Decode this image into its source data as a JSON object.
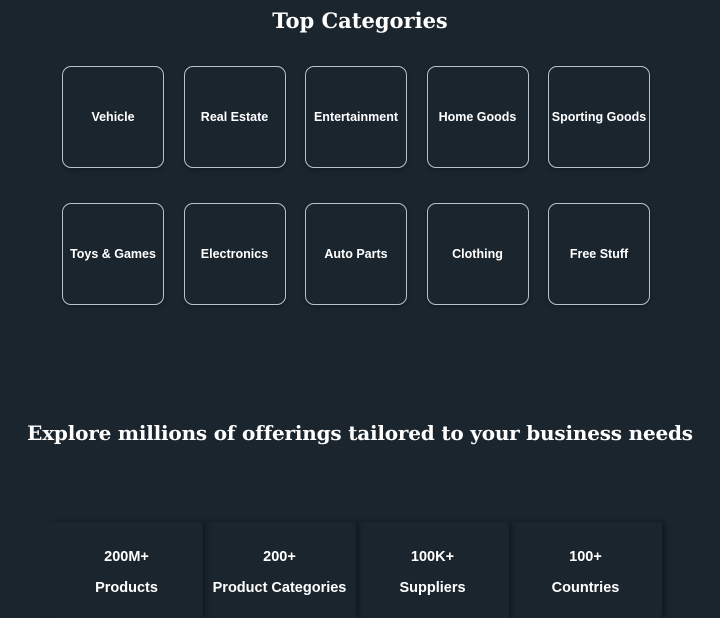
{
  "top_categories": {
    "title": "Top Categories",
    "items": [
      {
        "label": "Vehicle"
      },
      {
        "label": "Real Estate"
      },
      {
        "label": "Entertainment"
      },
      {
        "label": "Home Goods"
      },
      {
        "label": "Sporting Goods"
      },
      {
        "label": "Toys & Games"
      },
      {
        "label": "Electronics"
      },
      {
        "label": "Auto Parts"
      },
      {
        "label": "Clothing"
      },
      {
        "label": "Free Stuff"
      }
    ]
  },
  "explore": {
    "title": "Explore millions of offerings tailored to your business needs",
    "stats": [
      {
        "value": "200M+",
        "label": "Products"
      },
      {
        "value": "200+",
        "label": "Product Categories"
      },
      {
        "value": "100K+",
        "label": "Suppliers"
      },
      {
        "value": "100+",
        "label": "Countries"
      }
    ]
  },
  "colors": {
    "background": "#1b252e",
    "card_border": "#b8c2cb",
    "text": "#ffffff"
  }
}
